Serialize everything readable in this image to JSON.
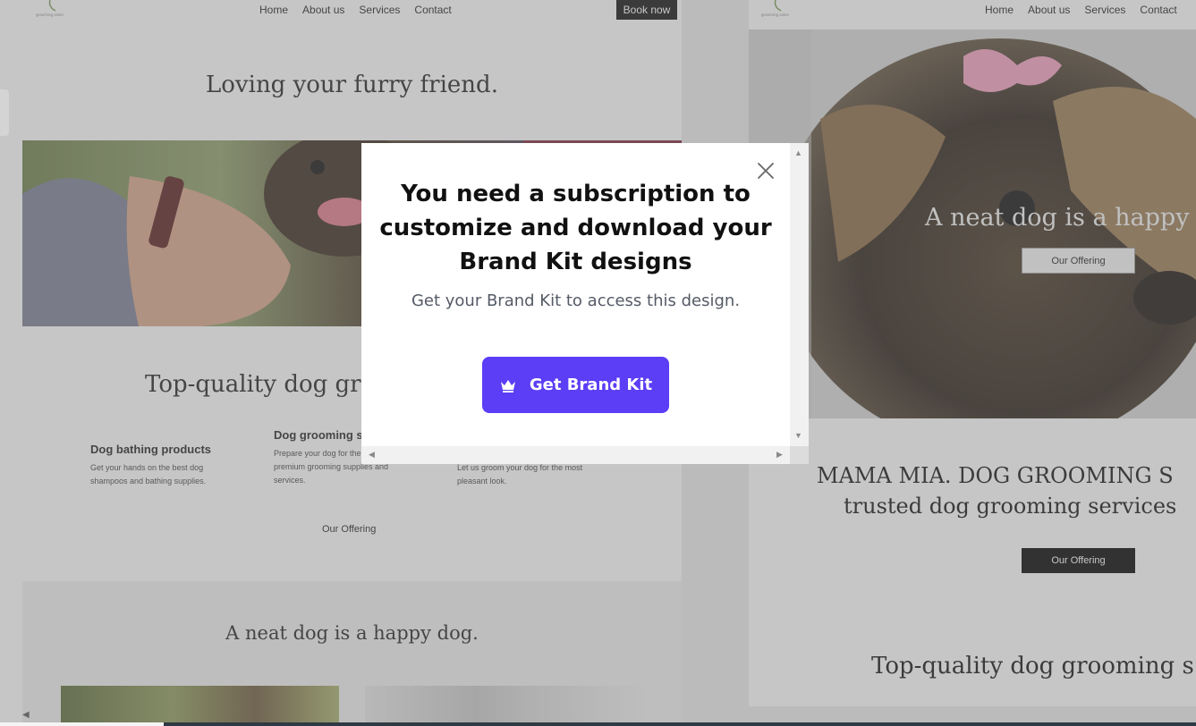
{
  "left_page": {
    "nav": [
      "Home",
      "About us",
      "Services",
      "Contact"
    ],
    "book_now": "Book now",
    "hero_title": "Loving your furry friend.",
    "section_title": "Top-quality dog gr",
    "features": [
      {
        "title": "Dog bathing products",
        "text": "Get your hands on the best dog shampoos and bathing supplies."
      },
      {
        "title": "Dog grooming su",
        "text": "Prepare your dog for the t using premium grooming supplies and services."
      },
      {
        "title": "",
        "text": "Let us groom your dog for the most pleasant look."
      }
    ],
    "offer_link": "Our Offering",
    "neat_title": "A neat dog is a happy dog."
  },
  "right_page": {
    "nav": [
      "Home",
      "About us",
      "Services",
      "Contact"
    ],
    "hero_title": "A neat dog is a happy d",
    "offer_outline": "Our Offering",
    "mama_line1": "MAMA MIA. DOG GROOMING S",
    "mama_line2": "trusted dog grooming services",
    "offer_dark": "Our Offering",
    "bottom_title": "Top-quality dog grooming s"
  },
  "modal": {
    "title": "You need a subscription to customize and download your Brand Kit designs",
    "subtitle": "Get your Brand Kit to access this design.",
    "cta_label": "Get Brand Kit",
    "cta_icon": "crown-icon",
    "close_icon": "close-icon",
    "cta_color": "#5b3ef5"
  }
}
